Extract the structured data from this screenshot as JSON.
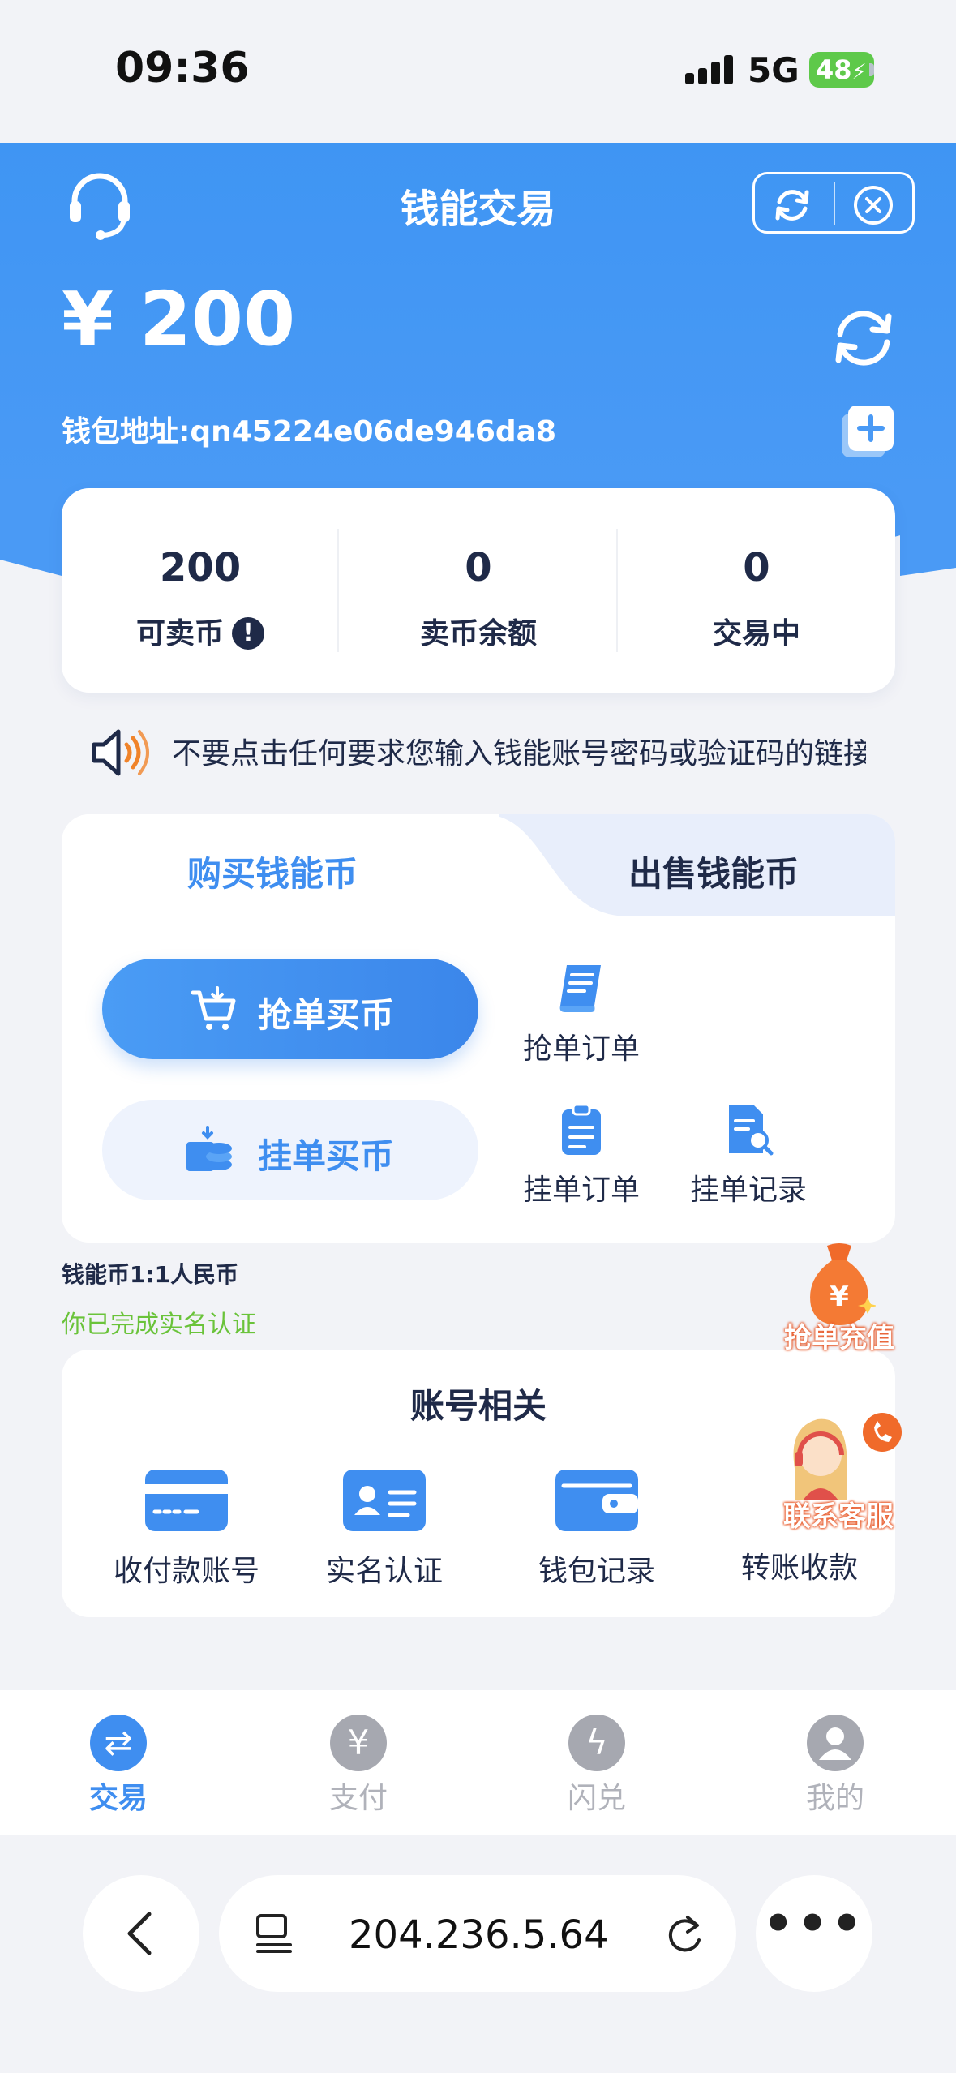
{
  "status_bar": {
    "time": "09:36",
    "network": "5G",
    "battery": "48"
  },
  "header": {
    "title": "钱能交易",
    "balance": "¥ 200",
    "wallet_address": "钱包地址:qn45224e06de946da8"
  },
  "summary": [
    {
      "value": "200",
      "label": "可卖币"
    },
    {
      "value": "0",
      "label": "卖币余额"
    },
    {
      "value": "0",
      "label": "交易中"
    }
  ],
  "notice": {
    "text": "不要点击任何要求您输入钱能账号密码或验证码的链接"
  },
  "trade": {
    "tab_buy": "购买钱能币",
    "tab_sell": "出售钱能币",
    "grab_buy_label": "抢单买币",
    "list_buy_label": "挂单买币",
    "grab_orders": "抢单订单",
    "list_orders": "挂单订单",
    "list_records": "挂单记录"
  },
  "rate_text": "钱能币1:1人民币",
  "verified_text": "你已完成实名认证",
  "account": {
    "title": "账号相关",
    "items": [
      {
        "label": "收付款账号",
        "icon": "card-icon"
      },
      {
        "label": "实名认证",
        "icon": "id-card-icon"
      },
      {
        "label": "钱包记录",
        "icon": "wallet-icon"
      },
      {
        "label": "转账收款",
        "icon": "transfer-icon"
      }
    ]
  },
  "floating": {
    "grab_recharge": "抢单充值",
    "customer_service": "联系客服"
  },
  "tabbar": [
    {
      "label": "交易",
      "icon": "swap-icon",
      "active": true
    },
    {
      "label": "支付",
      "icon": "yen-icon"
    },
    {
      "label": "闪兑",
      "icon": "flash-icon"
    },
    {
      "label": "我的",
      "icon": "user-icon"
    }
  ],
  "browser": {
    "url": "204.236.5.64"
  },
  "colors": {
    "primary": "#3f8ef0",
    "header_blue": "#4c9bf6",
    "green": "#6ac33a",
    "orange": "#f06a2a"
  }
}
